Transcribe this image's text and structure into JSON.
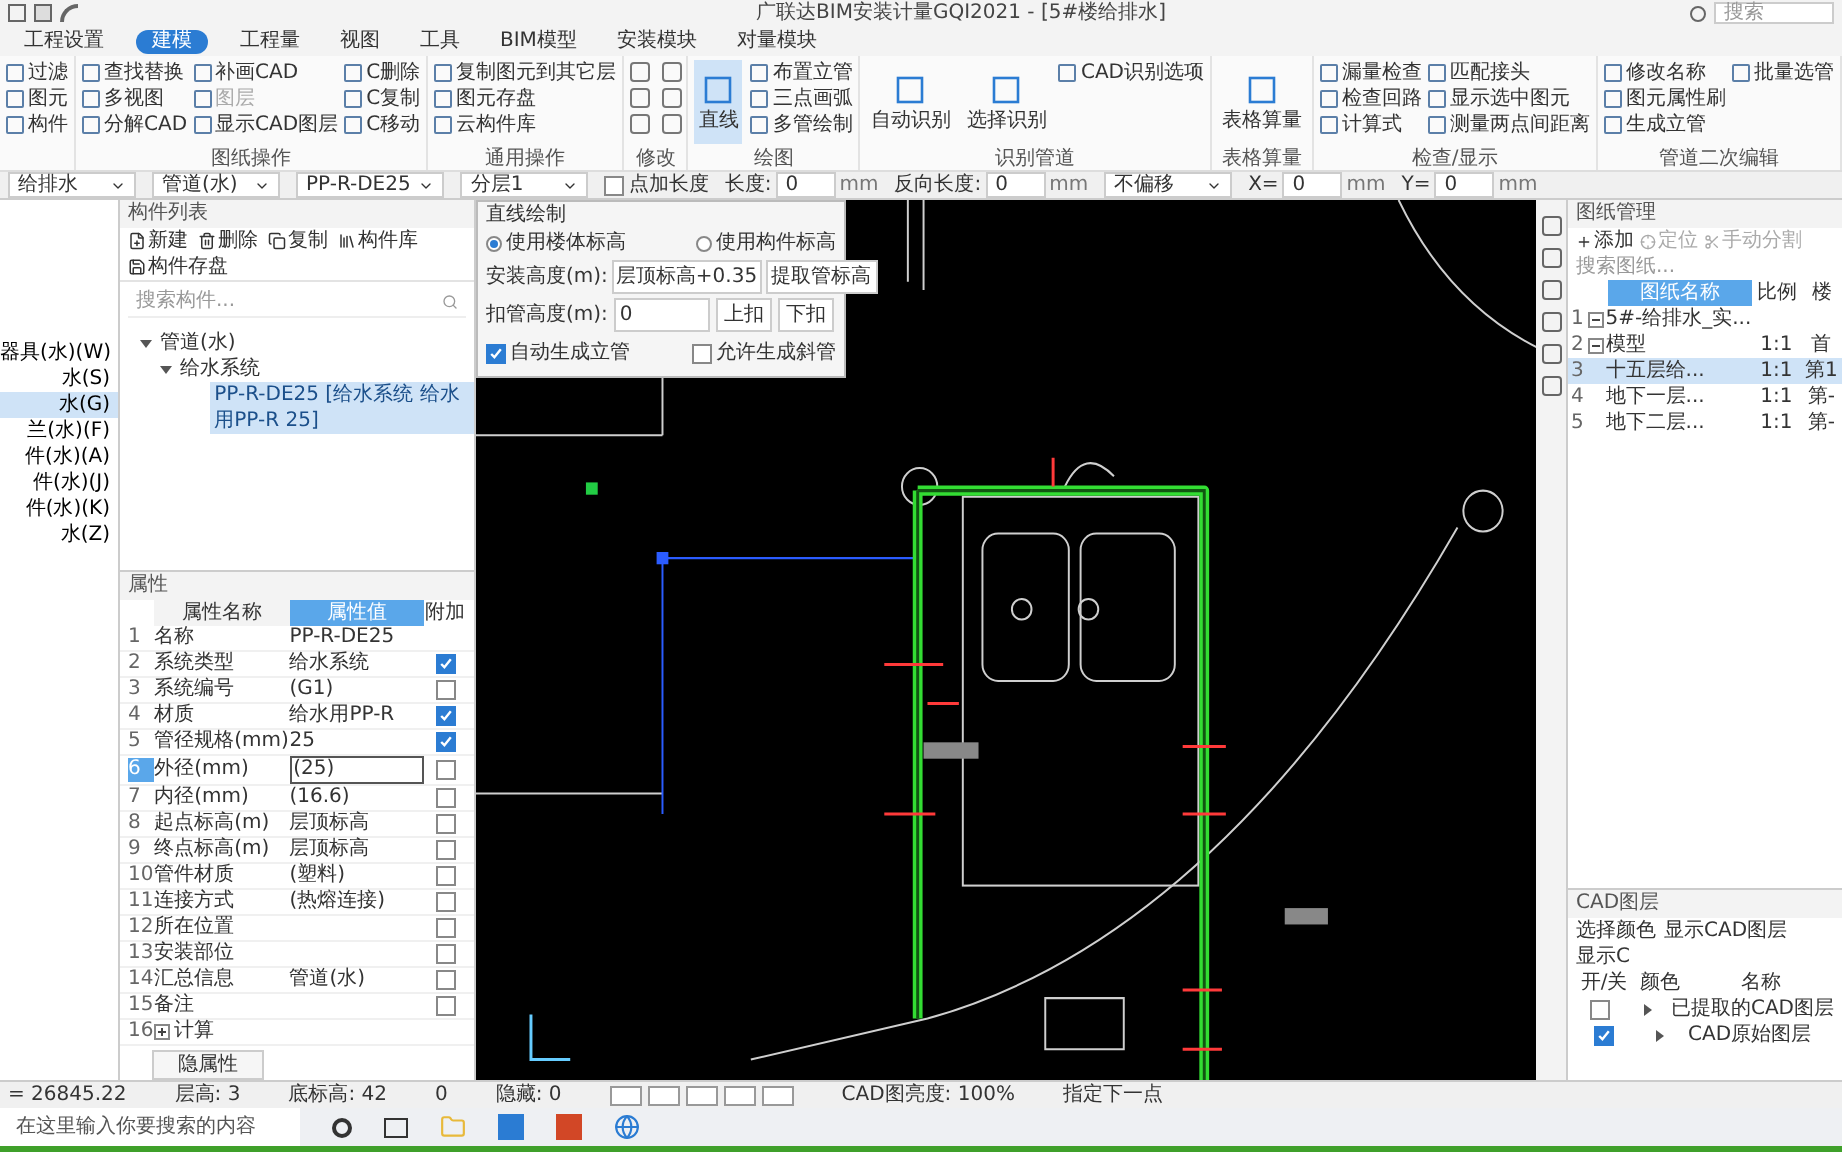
{
  "title_bar": {
    "title": "广联达BIM安装计量GQI2021 - [5#楼给排水]",
    "search_placeholder": "搜索"
  },
  "menu_tabs": [
    {
      "label": "工程设置",
      "selected": false
    },
    {
      "label": "建模",
      "selected": true
    },
    {
      "label": "工程量",
      "selected": false
    },
    {
      "label": "视图",
      "selected": false
    },
    {
      "label": "工具",
      "selected": false
    },
    {
      "label": "BIM模型",
      "selected": false
    },
    {
      "label": "安装模块",
      "selected": false
    },
    {
      "label": "对量模块",
      "selected": false
    }
  ],
  "ribbon_groups": [
    {
      "small_items": [
        {
          "label": "过滤",
          "disabled": false
        },
        {
          "label": "图元",
          "disabled": false
        },
        {
          "label": "构件",
          "disabled": false
        }
      ]
    },
    {
      "label": "图纸操作",
      "small_items": [
        {
          "label": "查找替换",
          "disabled": false
        },
        {
          "label": "多视图",
          "disabled": false
        },
        {
          "label": "分解CAD",
          "disabled": false
        },
        {
          "label": "补画CAD",
          "disabled": false
        },
        {
          "label": "图层",
          "disabled": true
        },
        {
          "label": "显示CAD图层",
          "disabled": false
        },
        {
          "label": "C删除",
          "disabled": false
        },
        {
          "label": "C复制",
          "disabled": false
        },
        {
          "label": "C移动",
          "disabled": false
        }
      ]
    },
    {
      "label": "通用操作",
      "small_items": [
        {
          "label": "复制图元到其它层",
          "disabled": false
        },
        {
          "label": "图元存盘",
          "disabled": false
        },
        {
          "label": "云构件库",
          "disabled": false
        }
      ]
    },
    {
      "label": "修改",
      "kind": "icons"
    },
    {
      "label": "绘图",
      "large_buttons": [
        {
          "label": "直线",
          "selected": true
        }
      ],
      "small_items": [
        {
          "label": "布置立管",
          "disabled": false
        },
        {
          "label": "三点画弧",
          "disabled": false
        },
        {
          "label": "多管绘制",
          "disabled": false
        }
      ]
    },
    {
      "label": "识别管道",
      "large_buttons": [
        {
          "label": "自动识别",
          "selected": false
        },
        {
          "label": "选择识别",
          "selected": false
        }
      ],
      "small_items": [
        {
          "label": "CAD识别选项",
          "disabled": false
        }
      ]
    },
    {
      "label": "表格算量",
      "large_buttons": [
        {
          "label": "表格算量",
          "selected": false
        }
      ]
    },
    {
      "label": "检查/显示",
      "small_items": [
        {
          "label": "漏量检查",
          "disabled": false
        },
        {
          "label": "检查回路",
          "disabled": false
        },
        {
          "label": "计算式",
          "disabled": false
        },
        {
          "label": "匹配接头",
          "disabled": false
        },
        {
          "label": "显示选中图元",
          "disabled": false
        },
        {
          "label": "测量两点间距离",
          "disabled": false
        }
      ]
    },
    {
      "label": "管道二次编辑",
      "small_items": [
        {
          "label": "修改名称",
          "disabled": false
        },
        {
          "label": "图元属性刷",
          "disabled": false
        },
        {
          "label": "生成立管",
          "disabled": false
        },
        {
          "label": "批量选管",
          "disabled": false
        }
      ]
    }
  ],
  "toolbar": [
    {
      "kind": "select",
      "value": "给排水"
    },
    {
      "kind": "select",
      "value": "管道(水)"
    },
    {
      "kind": "select",
      "value": "PP-R-DE25"
    },
    {
      "kind": "select",
      "value": "分层1"
    },
    {
      "kind": "checkbox",
      "label": "点加长度",
      "checked": false
    },
    {
      "kind": "field",
      "label": "长度:",
      "value": "0",
      "unit": "mm"
    },
    {
      "kind": "field",
      "label": "反向长度:",
      "value": "0",
      "unit": "mm"
    },
    {
      "kind": "select",
      "value": "不偏移"
    },
    {
      "kind": "field",
      "label": "X=",
      "value": "0",
      "unit": "mm"
    },
    {
      "kind": "field",
      "label": "Y=",
      "value": "0",
      "unit": "mm"
    }
  ],
  "navigation": [
    {
      "label": "器具(水)(W)",
      "selected": false
    },
    {
      "label": "水(S)",
      "selected": false
    },
    {
      "label": "水(G)",
      "selected": true
    },
    {
      "label": "兰(水)(F)",
      "selected": false
    },
    {
      "label": "件(水)(A)",
      "selected": false
    },
    {
      "label": "件(水)(J)",
      "selected": false
    },
    {
      "label": "件(水)(K)",
      "selected": false
    },
    {
      "label": "水(Z)",
      "selected": false
    }
  ],
  "component_list": {
    "title": "构件列表",
    "actions": [
      "新建",
      "删除",
      "复制",
      "构件库",
      "构件存盘"
    ],
    "search_placeholder": "搜索构件...",
    "tree": [
      {
        "label": "管道(水)",
        "expanded": true,
        "selected": false,
        "children": [
          {
            "label": "给水系统",
            "expanded": true,
            "selected": false,
            "children": [
              {
                "label": "PP-R-DE25 [给水系统 给水用PP-R 25]",
                "selected": true
              }
            ]
          }
        ]
      }
    ]
  },
  "properties": {
    "title": "属性",
    "columns": [
      "属性名称",
      "属性值",
      "附加"
    ],
    "rows": [
      {
        "no": "1",
        "name": "名称",
        "value": "PP-R-DE25",
        "kind": "plain",
        "selected": false
      },
      {
        "no": "2",
        "name": "系统类型",
        "value": "给水系统",
        "kind": "check",
        "checked": true,
        "selected": false
      },
      {
        "no": "3",
        "name": "系统编号",
        "value": "(G1)",
        "kind": "check",
        "checked": false,
        "selected": false
      },
      {
        "no": "4",
        "name": "材质",
        "value": "给水用PP-R",
        "kind": "check",
        "checked": true,
        "selected": false
      },
      {
        "no": "5",
        "name": "管径规格(mm)",
        "value": "25",
        "kind": "check",
        "checked": true,
        "selected": false
      },
      {
        "no": "6",
        "name": "外径(mm)",
        "value": "(25)",
        "kind": "check",
        "checked": false,
        "selected": true
      },
      {
        "no": "7",
        "name": "内径(mm)",
        "value": "(16.6)",
        "kind": "check",
        "checked": false,
        "selected": false
      },
      {
        "no": "8",
        "name": "起点标高(m)",
        "value": "层顶标高",
        "kind": "check",
        "checked": false,
        "selected": false
      },
      {
        "no": "9",
        "name": "终点标高(m)",
        "value": "层顶标高",
        "kind": "check",
        "checked": false,
        "selected": false
      },
      {
        "no": "10",
        "name": "管件材质",
        "value": "(塑料)",
        "kind": "check",
        "checked": false,
        "selected": false
      },
      {
        "no": "11",
        "name": "连接方式",
        "value": "(热熔连接)",
        "kind": "check",
        "checked": false,
        "selected": false
      },
      {
        "no": "12",
        "name": "所在位置",
        "kind": "check",
        "checked": false,
        "selected": false
      },
      {
        "no": "13",
        "name": "安装部位",
        "kind": "check",
        "checked": false,
        "selected": false
      },
      {
        "no": "14",
        "name": "汇总信息",
        "value": "管道(水)",
        "kind": "check",
        "checked": false,
        "selected": false
      },
      {
        "no": "15",
        "name": "备注",
        "kind": "check",
        "checked": false,
        "selected": false
      },
      {
        "no": "16",
        "name": "计算",
        "kind": "group",
        "selected": false
      }
    ],
    "button": "隐属性"
  },
  "line_dialog": {
    "title": "直线绘制",
    "radios": [
      {
        "label": "使用楼体标高",
        "selected": true
      },
      {
        "label": "使用构件标高",
        "selected": false
      }
    ],
    "install_height": {
      "label": "安装高度(m):",
      "value": "层顶标高+0.35",
      "button": "提取管标高"
    },
    "bend_height": {
      "label": "扣管高度(m):",
      "value": "0",
      "buttons": [
        "上扣",
        "下扣"
      ]
    },
    "checkboxes": [
      {
        "label": "自动生成立管",
        "checked": true
      },
      {
        "label": "允许生成斜管",
        "checked": false
      }
    ]
  },
  "drawing_manager": {
    "title": "图纸管理",
    "actions": [
      "添加",
      "定位",
      "手动分割"
    ],
    "search_placeholder": "搜索图纸...",
    "columns": [
      "图纸名称",
      "比例",
      "楼"
    ],
    "rows": [
      {
        "no": "1",
        "name": "5#-给排水_实...",
        "expanded": true,
        "selected": false
      },
      {
        "no": "2",
        "name": "模型",
        "scale": "1:1",
        "floor": "首",
        "expanded": true,
        "selected": false
      },
      {
        "no": "3",
        "name": "十五层给...",
        "scale": "1:1",
        "floor": "第1",
        "selected": true
      },
      {
        "no": "4",
        "name": "地下一层...",
        "scale": "1:1",
        "floor": "第-",
        "selected": false
      },
      {
        "no": "5",
        "name": "地下二层...",
        "scale": "1:1",
        "floor": "第-",
        "selected": false
      }
    ]
  },
  "cad_layers": {
    "title": "CAD图层",
    "actions": [
      "选择颜色",
      "显示CAD图层",
      "显示C"
    ],
    "columns": [
      "开/关",
      "颜色",
      "名称"
    ],
    "rows": [
      {
        "name": "已提取的CAD图层",
        "checked": false
      },
      {
        "name": "CAD原始图层",
        "checked": true
      }
    ]
  },
  "status_bar": {
    "coordinate": "= 26845.22",
    "floor_height": "层高: 3",
    "bottom_elevation": "底标高: 42",
    "value": "0",
    "hidden": "隐藏: 0",
    "cad_brightness": "CAD图亮度: 100%",
    "prompt": "指定下一点"
  },
  "taskbar": {
    "search_placeholder": "在这里输入你要搜索的内容"
  }
}
